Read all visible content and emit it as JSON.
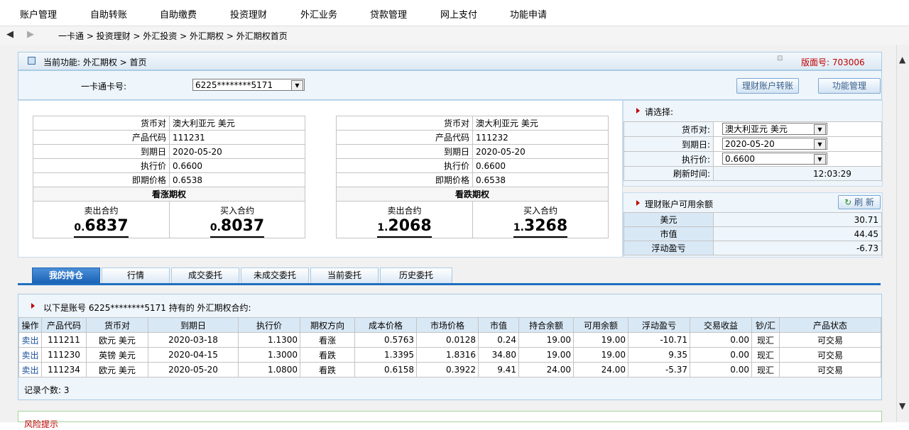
{
  "topnav": [
    "账户管理",
    "自助转账",
    "自助缴费",
    "投资理财",
    "外汇业务",
    "贷款管理",
    "网上支付",
    "功能申请"
  ],
  "breadcrumb": {
    "back": "◀",
    "forward": "▶",
    "path": "一卡通 > 投资理财 > 外汇投资 > 外汇期权 > 外汇期权首页"
  },
  "header": {
    "title": "当前功能:  外汇期权 > 首页",
    "version": "版面号: 703006"
  },
  "card": {
    "label": "一卡通卡号:",
    "value": "6225********5171"
  },
  "buttons": {
    "transfer": "理财账户转账",
    "manage": "功能管理",
    "refresh": "刷 新"
  },
  "call_option": {
    "pair_label": "货币对",
    "pair": "澳大利亚元 美元",
    "code_label": "产品代码",
    "code": "111231",
    "expiry_label": "到期日",
    "expiry": "2020-05-20",
    "strike_label": "执行价",
    "strike": "0.6600",
    "spot_label": "即期价格",
    "spot": "0.6538",
    "type": "看涨期权",
    "sell_label": "卖出合约",
    "sell_int": "0.",
    "sell_dec": "6837",
    "buy_label": "买入合约",
    "buy_int": "0.",
    "buy_dec": "8037"
  },
  "put_option": {
    "pair_label": "货币对",
    "pair": "澳大利亚元 美元",
    "code_label": "产品代码",
    "code": "111232",
    "expiry_label": "到期日",
    "expiry": "2020-05-20",
    "strike_label": "执行价",
    "strike": "0.6600",
    "spot_label": "即期价格",
    "spot": "0.6538",
    "type": "看跌期权",
    "sell_label": "卖出合约",
    "sell_int": "1.",
    "sell_dec": "2068",
    "buy_label": "买入合约",
    "buy_int": "1.",
    "buy_dec": "3268"
  },
  "selector": {
    "title": "请选择:",
    "pair_label": "货币对:",
    "pair": "澳大利亚元 美元",
    "expiry_label": "到期日:",
    "expiry": "2020-05-20",
    "strike_label": "执行价:",
    "strike": "0.6600",
    "refresh_label": "刷新时间:",
    "refresh_time": "12:03:29"
  },
  "balance": {
    "title": "理财账户可用余额",
    "rows": [
      {
        "label": "美元",
        "value": "30.71"
      },
      {
        "label": "市值",
        "value": "44.45"
      },
      {
        "label": "浮动盈亏",
        "value": "-6.73"
      }
    ]
  },
  "tabs": [
    "我的持仓",
    "行情",
    "成交委托",
    "未成交委托",
    "当前委托",
    "历史委托"
  ],
  "holdings": {
    "caption": "以下是账号 6225********5171 持有的 外汇期权合约:",
    "columns": [
      "操作",
      "产品代码",
      "货币对",
      "到期日",
      "执行价",
      "期权方向",
      "成本价格",
      "市场价格",
      "市值",
      "持合余额",
      "可用余额",
      "浮动盈亏",
      "交易收益",
      "钞/汇",
      "产品状态"
    ],
    "rows": [
      [
        "卖出",
        "111211",
        "欧元 美元",
        "2020-03-18",
        "1.1300",
        "看涨",
        "0.5763",
        "0.0128",
        "0.24",
        "19.00",
        "19.00",
        "-10.71",
        "0.00",
        "现汇",
        "可交易"
      ],
      [
        "卖出",
        "111230",
        "英镑 美元",
        "2020-04-15",
        "1.3000",
        "看跌",
        "1.3395",
        "1.8316",
        "34.80",
        "19.00",
        "19.00",
        "9.35",
        "0.00",
        "现汇",
        "可交易"
      ],
      [
        "卖出",
        "111234",
        "欧元 美元",
        "2020-05-20",
        "1.0800",
        "看跌",
        "0.6158",
        "0.3922",
        "9.41",
        "24.00",
        "24.00",
        "-5.37",
        "0.00",
        "现汇",
        "可交易"
      ]
    ],
    "count": "记录个数:  3"
  },
  "risk": {
    "title": "风险提示"
  }
}
